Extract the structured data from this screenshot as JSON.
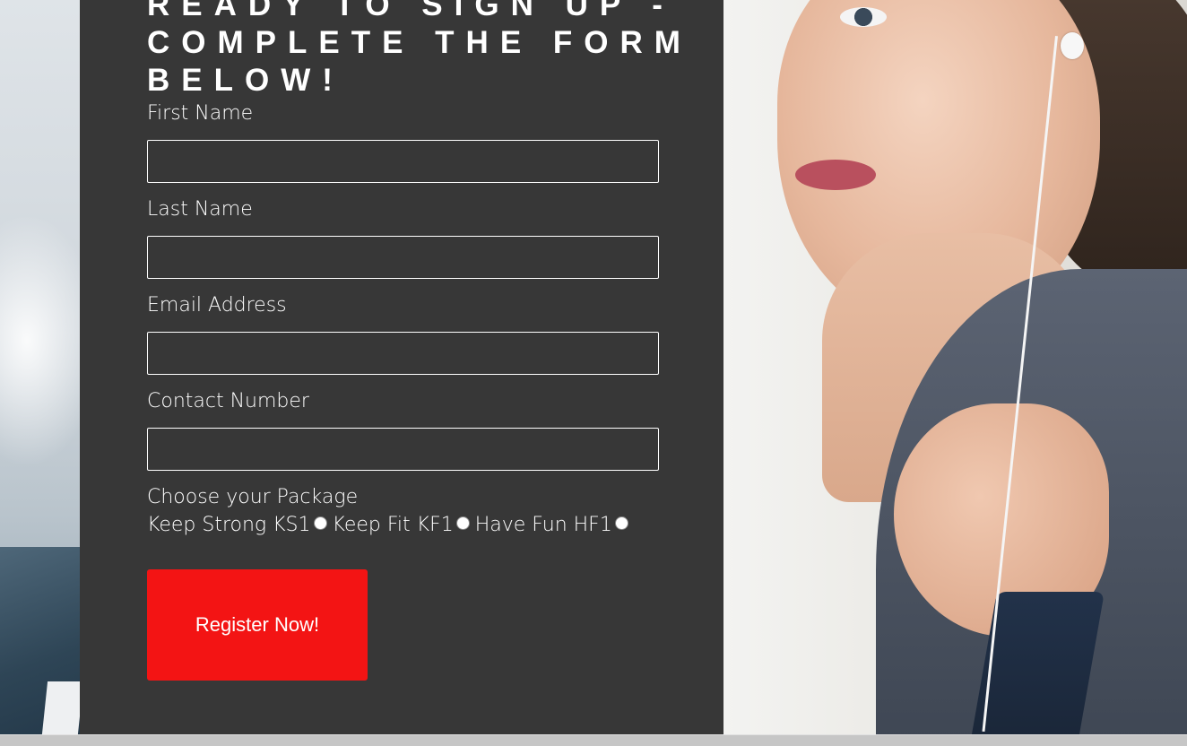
{
  "form": {
    "heading": "READY TO SIGN UP - COMPLETE THE FORM BELOW!",
    "fields": [
      {
        "label": "First Name",
        "value": ""
      },
      {
        "label": "Last Name",
        "value": ""
      },
      {
        "label": "Email Address",
        "value": ""
      },
      {
        "label": "Contact Number",
        "value": ""
      }
    ],
    "package": {
      "label": "Choose your Package",
      "options": [
        {
          "label": "Keep Strong KS1",
          "selected": false
        },
        {
          "label": "Keep Fit KF1",
          "selected": false
        },
        {
          "label": "Have Fun HF1",
          "selected": false
        }
      ]
    },
    "submit_label": "Register Now!"
  },
  "colors": {
    "panel": "#373737",
    "button": "#f31414",
    "text": "#ffffff"
  }
}
